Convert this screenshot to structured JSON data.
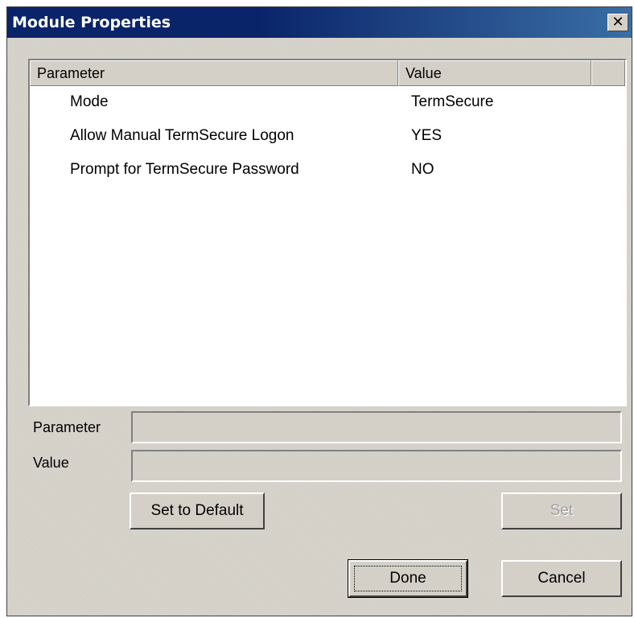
{
  "window": {
    "title": "Module Properties",
    "close_glyph": "✕"
  },
  "list": {
    "columns": [
      "Parameter",
      "Value"
    ],
    "rows": [
      {
        "parameter": "Mode",
        "value": "TermSecure"
      },
      {
        "parameter": "Allow Manual TermSecure Logon",
        "value": "YES"
      },
      {
        "parameter": "Prompt for TermSecure Password",
        "value": "NO"
      }
    ]
  },
  "form": {
    "parameter_label": "Parameter",
    "parameter_value": "",
    "value_label": "Value",
    "value_value": ""
  },
  "buttons": {
    "set_default": "Set to Default",
    "set": "Set",
    "done": "Done",
    "cancel": "Cancel"
  },
  "colors": {
    "title_bar": "#0a246a",
    "dialog_face": "#d4d0c8"
  }
}
